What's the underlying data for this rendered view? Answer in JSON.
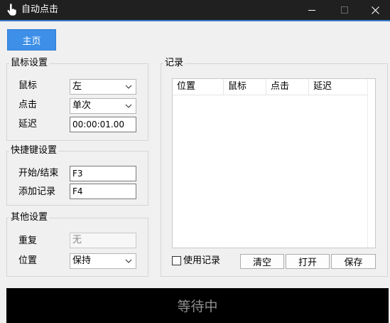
{
  "window": {
    "title": "自动点击",
    "app_icon": "pointer-hand-icon",
    "controls": [
      "minimize-icon",
      "maximize-icon",
      "close-icon"
    ]
  },
  "nav": {
    "home_label": "主页"
  },
  "mouse_settings": {
    "legend": "鼠标设置",
    "mouse_label": "鼠标",
    "mouse_value": "左",
    "click_label": "点击",
    "click_value": "单次",
    "delay_label": "延迟",
    "delay_value": "00:00:01.00"
  },
  "hotkey_settings": {
    "legend": "快捷键设置",
    "start_stop_label": "开始/结束",
    "start_stop_value": "F3",
    "add_record_label": "添加记录",
    "add_record_value": "F4"
  },
  "other_settings": {
    "legend": "其他设置",
    "repeat_label": "重复",
    "repeat_value": "无",
    "position_label": "位置",
    "position_value": "保持"
  },
  "records": {
    "legend": "记录",
    "columns": [
      "位置",
      "鼠标",
      "点击",
      "延迟"
    ],
    "rows": [],
    "use_records_label": "使用记录",
    "use_records_checked": false,
    "clear_label": "清空",
    "open_label": "打开",
    "save_label": "保存"
  },
  "status": {
    "text": "等待中"
  },
  "colors": {
    "accent": "#3d8fe8",
    "titlebar": "#202020",
    "status_bg": "#000000",
    "status_text": "#8e8e8e"
  }
}
